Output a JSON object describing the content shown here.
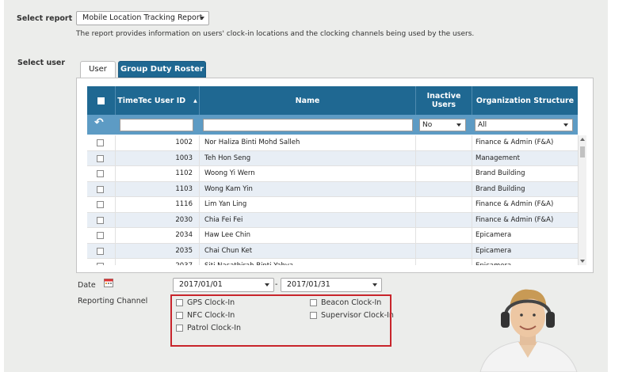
{
  "report": {
    "label": "Select report",
    "selected": "Mobile Location Tracking Report",
    "description": "The report provides information on users' clock-in locations and the clocking channels being used by the users."
  },
  "user": {
    "label": "Select user",
    "tabs": [
      "User",
      "Group Duty Roster"
    ]
  },
  "grid": {
    "columns": {
      "id": "TimeTec User ID",
      "name": "Name",
      "inactive": "Inactive Users",
      "org": "Organization Structure"
    },
    "filters": {
      "inactive": "No",
      "org": "All"
    },
    "rows": [
      {
        "id": "1002",
        "name": "Nor Haliza Binti Mohd Salleh",
        "org": "Finance & Admin (F&A)"
      },
      {
        "id": "1003",
        "name": "Teh Hon Seng",
        "org": "Management"
      },
      {
        "id": "1102",
        "name": "Woong Yi Wern",
        "org": "Brand Building"
      },
      {
        "id": "1103",
        "name": "Wong Kam Yin",
        "org": "Brand Building"
      },
      {
        "id": "1116",
        "name": "Lim Yan Ling",
        "org": "Finance & Admin (F&A)"
      },
      {
        "id": "2030",
        "name": "Chia Fei Fei",
        "org": "Finance & Admin (F&A)"
      },
      {
        "id": "2034",
        "name": "Haw Lee Chin",
        "org": "Epicamera"
      },
      {
        "id": "2035",
        "name": "Chai Chun Ket",
        "org": "Epicamera"
      },
      {
        "id": "2037",
        "name": "Siti Nasathirah Binti Yahya",
        "org": "Epicamera"
      }
    ]
  },
  "date": {
    "label": "Date",
    "from": "2017/01/01",
    "separator": "-",
    "to": "2017/01/31"
  },
  "channel": {
    "label": "Reporting Channel",
    "options": [
      "GPS Clock-In",
      "NFC Clock-In",
      "Patrol Clock-In",
      "Beacon Clock-In",
      "Supervisor Clock-In"
    ]
  },
  "colors": {
    "header": "#1f6892",
    "filter_bar": "#5d9bc4",
    "alt_row": "#e8eef5",
    "highlight": "#c8242b",
    "panel": "#ecedeb"
  },
  "icons": [
    "calendar-icon",
    "reset-icon",
    "sort-asc-icon",
    "chevron-down-icon",
    "headphones-person-illustration"
  ]
}
